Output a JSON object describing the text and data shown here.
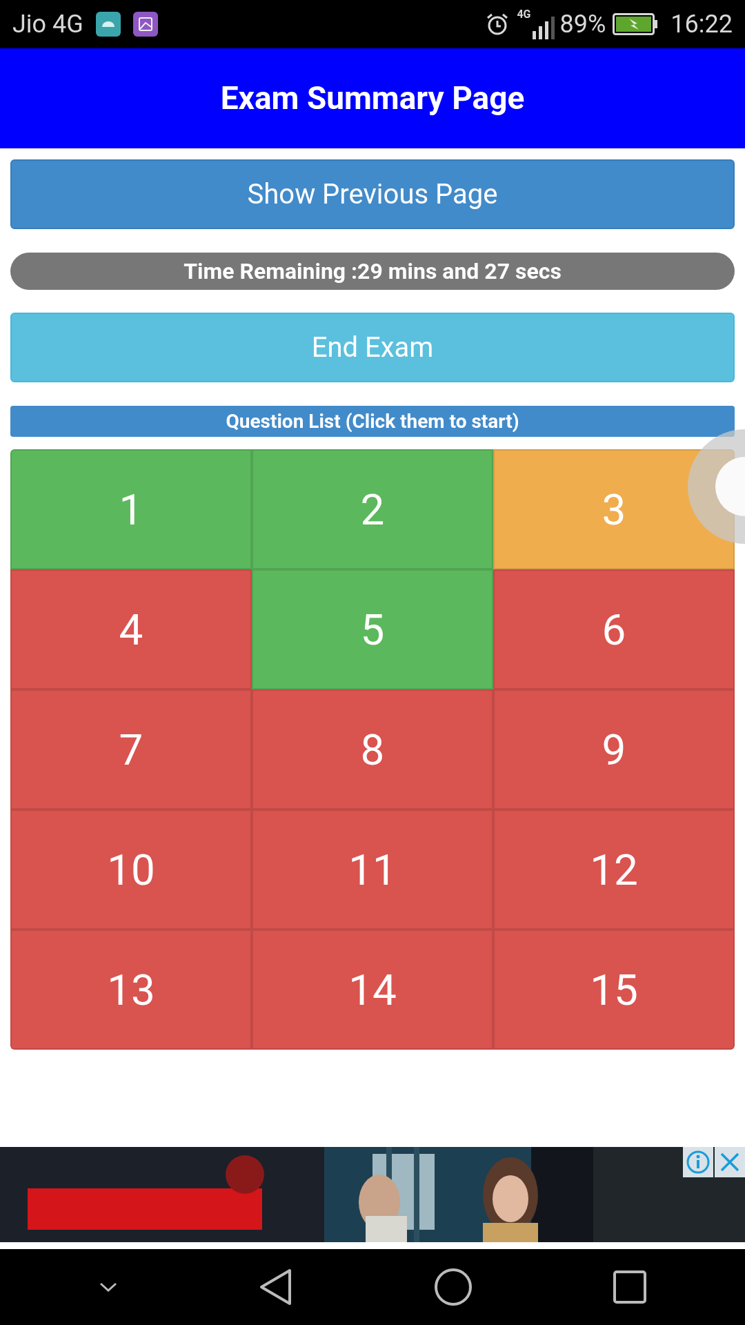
{
  "status_bar": {
    "carrier": "Jio 4G",
    "network": "4G",
    "battery": "89%",
    "time": "16:22"
  },
  "header": {
    "title": "Exam Summary Page"
  },
  "previous_button": "Show Previous Page",
  "timer": "Time Remaining :29 mins and 27 secs",
  "end_button": "End Exam",
  "question_list": {
    "title": "Question List (Click them to start)",
    "questions": [
      {
        "label": "1",
        "color": "#5cb85c"
      },
      {
        "label": "2",
        "color": "#5cb85c"
      },
      {
        "label": "3",
        "color": "#f0ad4e"
      },
      {
        "label": "4",
        "color": "#d9534f"
      },
      {
        "label": "5",
        "color": "#5cb85c"
      },
      {
        "label": "6",
        "color": "#d9534f"
      },
      {
        "label": "7",
        "color": "#d9534f"
      },
      {
        "label": "8",
        "color": "#d9534f"
      },
      {
        "label": "9",
        "color": "#d9534f"
      },
      {
        "label": "10",
        "color": "#d9534f"
      },
      {
        "label": "11",
        "color": "#d9534f"
      },
      {
        "label": "12",
        "color": "#d9534f"
      },
      {
        "label": "13",
        "color": "#d9534f"
      },
      {
        "label": "14",
        "color": "#d9534f"
      },
      {
        "label": "15",
        "color": "#d9534f"
      }
    ]
  }
}
